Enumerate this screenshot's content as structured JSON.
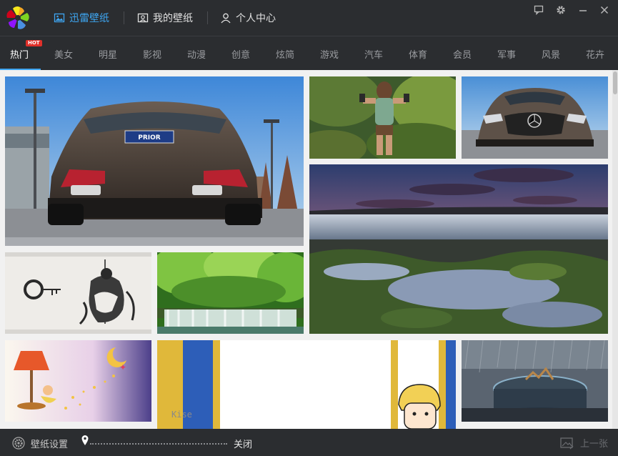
{
  "header": {
    "tabs": [
      {
        "label": "迅雷壁纸",
        "icon": "image-icon",
        "active": true
      },
      {
        "label": "我的壁纸",
        "icon": "my-wallpaper-icon",
        "active": false
      },
      {
        "label": "个人中心",
        "icon": "user-icon",
        "active": false
      }
    ],
    "window_buttons": [
      "feedback-icon",
      "settings-gear-icon",
      "minimize-icon",
      "close-icon"
    ],
    "accent_color": "#3ea6f2"
  },
  "categories": {
    "items": [
      "热门",
      "美女",
      "明星",
      "影视",
      "动漫",
      "创意",
      "炫简",
      "游戏",
      "汽车",
      "体育",
      "会员",
      "军事",
      "风景",
      "花卉"
    ],
    "active_index": 0,
    "hot_badge": "HOT"
  },
  "gallery": {
    "tiles": [
      {
        "name": "car-rear-wallpaper",
        "plate_text": "PRIOR"
      },
      {
        "name": "game-heroine-wallpaper"
      },
      {
        "name": "car-front-wallpaper"
      },
      {
        "name": "sunset-shore-wallpaper"
      },
      {
        "name": "ink-samurai-wallpaper"
      },
      {
        "name": "forest-waterfall-wallpaper"
      },
      {
        "name": "cartoon-lamp-moon-wallpaper"
      },
      {
        "name": "cartoon-boy-kise-wallpaper",
        "caption": "Kise"
      },
      {
        "name": "fantasy-rain-wallpaper"
      }
    ]
  },
  "footer": {
    "settings_label": "壁纸设置",
    "close_label": "关闭",
    "prev_label": "上一张"
  }
}
